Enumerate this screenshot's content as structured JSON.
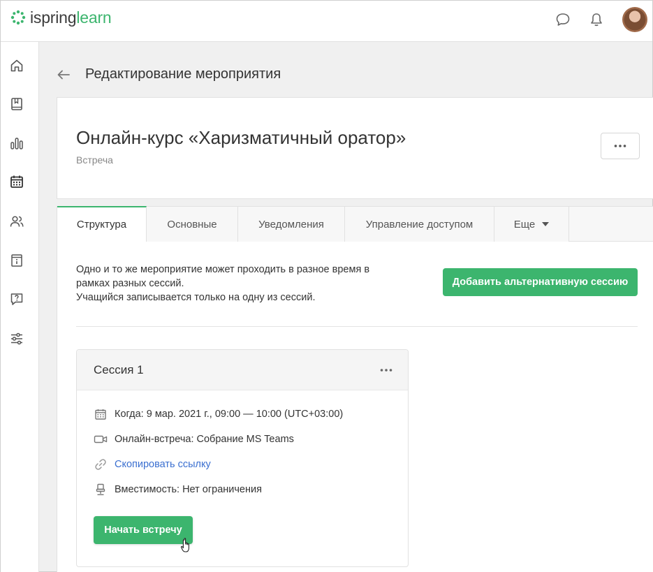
{
  "brand": {
    "name_part1": "ispring",
    "name_part2": "learn",
    "accent": "#3cb56e"
  },
  "header": {
    "chat_icon": "chat-bubble-icon",
    "bell_icon": "bell-icon"
  },
  "sidebar": {
    "items": [
      {
        "name": "home-icon"
      },
      {
        "name": "book-icon"
      },
      {
        "name": "bar-chart-icon"
      },
      {
        "name": "calendar-icon"
      },
      {
        "name": "users-icon"
      },
      {
        "name": "info-icon"
      },
      {
        "name": "question-icon"
      },
      {
        "name": "sliders-icon"
      }
    ]
  },
  "page": {
    "title": "Редактирование мероприятия"
  },
  "event": {
    "title": "Онлайн-курс «Харизматичный оратор»",
    "type": "Встреча",
    "more_label": "•••"
  },
  "tabs": [
    {
      "label": "Структура",
      "active": true
    },
    {
      "label": "Основные"
    },
    {
      "label": "Уведомления"
    },
    {
      "label": "Управление доступом"
    },
    {
      "label": "Еще"
    }
  ],
  "content": {
    "info_line1": "Одно и то же мероприятие может проходить в разное время в",
    "info_line2": "рамках разных сессий.",
    "info_line3": "Учащийся записывается только на одну из сессий.",
    "add_session_label": "Добавить альтернативную сессию"
  },
  "session": {
    "title": "Сессия 1",
    "more_label": "•••",
    "when": "Когда: 9 мар. 2021 г., 09:00 — 10:00 (UTC+03:00)",
    "meeting": "Онлайн-встреча: Собрание MS Teams",
    "copy_link": "Скопировать ссылку",
    "capacity": "Вместимость: Нет ограничения",
    "start_label": "Начать встречу"
  }
}
